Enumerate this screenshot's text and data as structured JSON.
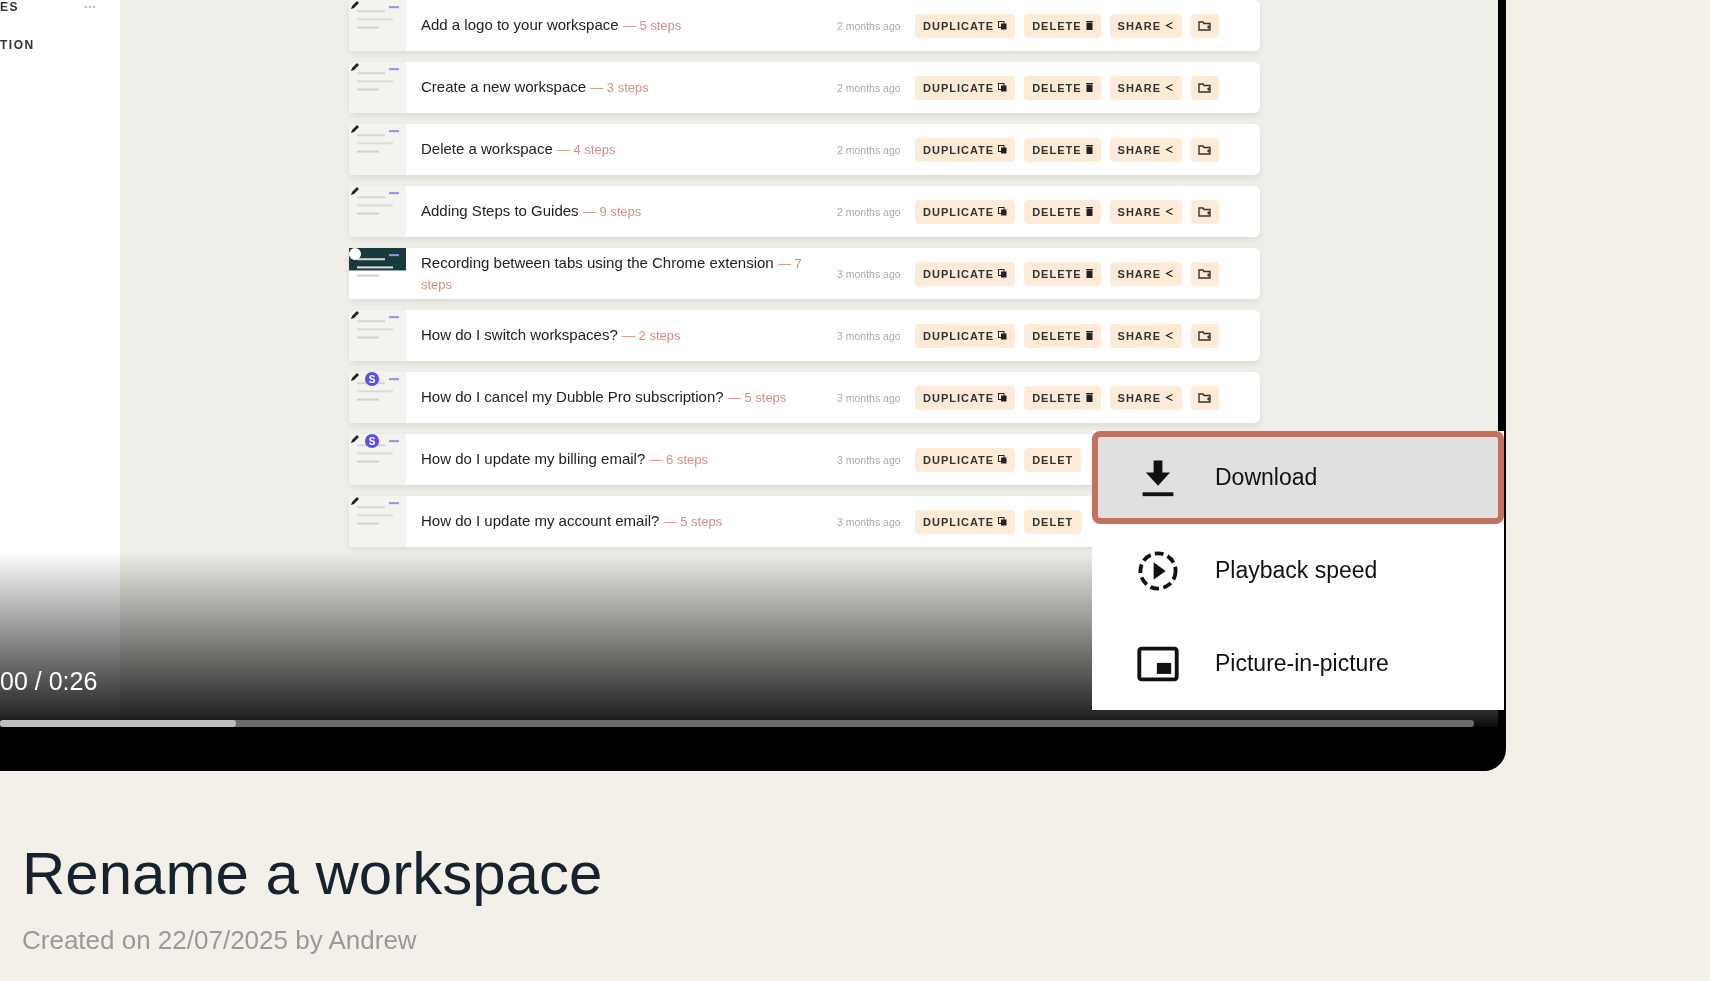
{
  "sidebar": {
    "items": [
      {
        "label": "ES"
      },
      {
        "label": "TION"
      }
    ]
  },
  "guides": [
    {
      "title": "Add a logo to your workspace",
      "steps": "— 5 steps",
      "time": "2 months ago",
      "kind": "edited",
      "actions": [
        {
          "label": "DUPLICATE",
          "kind": "duplicate"
        },
        {
          "label": "DELETE",
          "kind": "delete"
        },
        {
          "label": "SHARE",
          "kind": "share"
        },
        {
          "kind": "folder"
        }
      ]
    },
    {
      "title": "Create a new workspace",
      "steps": "— 3 steps",
      "time": "2 months ago",
      "kind": "edited",
      "actions": [
        {
          "label": "DUPLICATE",
          "kind": "duplicate"
        },
        {
          "label": "DELETE",
          "kind": "delete"
        },
        {
          "label": "SHARE",
          "kind": "share"
        },
        {
          "kind": "folder"
        }
      ]
    },
    {
      "title": "Delete a workspace",
      "steps": "— 4 steps",
      "time": "2 months ago",
      "kind": "edited",
      "actions": [
        {
          "label": "DUPLICATE",
          "kind": "duplicate"
        },
        {
          "label": "DELETE",
          "kind": "delete"
        },
        {
          "label": "SHARE",
          "kind": "share"
        },
        {
          "kind": "folder"
        }
      ]
    },
    {
      "title": "Adding Steps to Guides",
      "steps": "— 9 steps",
      "time": "2 months ago",
      "kind": "edited",
      "actions": [
        {
          "label": "DUPLICATE",
          "kind": "duplicate"
        },
        {
          "label": "DELETE",
          "kind": "delete"
        },
        {
          "label": "SHARE",
          "kind": "share"
        },
        {
          "kind": "folder"
        }
      ]
    },
    {
      "title": "Recording between tabs using the Chrome extension",
      "steps": "— 7 steps",
      "time": "3 months ago",
      "kind": "recording",
      "actions": [
        {
          "label": "DUPLICATE",
          "kind": "duplicate"
        },
        {
          "label": "DELETE",
          "kind": "delete"
        },
        {
          "label": "SHARE",
          "kind": "share"
        },
        {
          "kind": "folder"
        }
      ]
    },
    {
      "title": "How do I switch workspaces?",
      "steps": "— 2 steps",
      "time": "3 months ago",
      "kind": "edited",
      "actions": [
        {
          "label": "DUPLICATE",
          "kind": "duplicate"
        },
        {
          "label": "DELETE",
          "kind": "delete"
        },
        {
          "label": "SHARE",
          "kind": "share"
        },
        {
          "kind": "folder"
        }
      ]
    },
    {
      "title": "How do I cancel my Dubble Pro subscription?",
      "steps": "— 5 steps",
      "time": "3 months ago",
      "kind": "edited",
      "badge": "S",
      "actions": [
        {
          "label": "DUPLICATE",
          "kind": "duplicate"
        },
        {
          "label": "DELETE",
          "kind": "delete"
        },
        {
          "label": "SHARE",
          "kind": "share"
        },
        {
          "kind": "folder"
        }
      ]
    },
    {
      "title": "How do I update my billing email?",
      "steps": "— 6 steps",
      "time": "3 months ago",
      "kind": "edited",
      "badge": "S",
      "actions": [
        {
          "label": "DUPLICATE",
          "kind": "duplicate"
        },
        {
          "label": "DELET",
          "kind": "cut"
        }
      ]
    },
    {
      "title": "How do I update my account email?",
      "steps": "— 5 steps",
      "time": "3 months ago",
      "kind": "edited",
      "actions": [
        {
          "label": "DUPLICATE",
          "kind": "duplicate"
        },
        {
          "label": "DELET",
          "kind": "cut"
        }
      ]
    }
  ],
  "player": {
    "time": "00 / 0:26",
    "progress": {
      "level": 0.16
    }
  },
  "menu": {
    "items": [
      {
        "label": "Download",
        "kind": "download",
        "selected": true
      },
      {
        "label": "Playback speed",
        "kind": "speed",
        "selected": false
      },
      {
        "label": "Picture-in-picture",
        "kind": "pip",
        "selected": false
      }
    ]
  },
  "page": {
    "title": "Rename a workspace",
    "meta": "Created on 22/07/2025 by Andrew"
  }
}
